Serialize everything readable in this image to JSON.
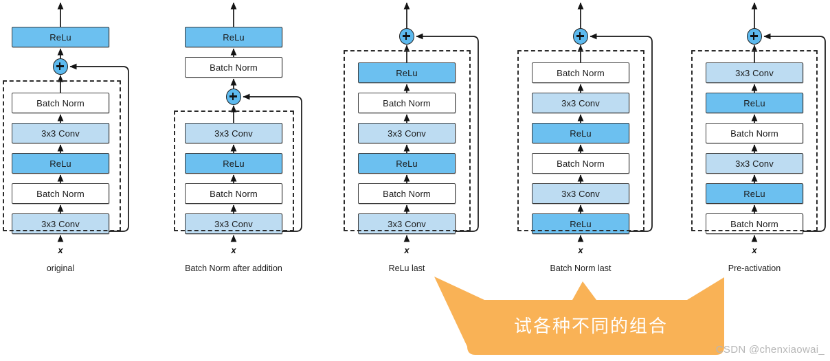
{
  "diagram": {
    "title": "ResNet block variants",
    "colors": {
      "relu_fill": "#6cc0f0",
      "conv_fill": "#bddcf2",
      "bn_fill": "#ffffff",
      "plus_fill": "#5cb9ee",
      "stroke": "#3b3b3b",
      "banner_fill": "#f9b košt"
    },
    "input_label": "x",
    "plus_label": "+",
    "columns": [
      {
        "caption": "original",
        "outside_top_blocks": [
          {
            "label": "ReLu",
            "kind": "relu"
          }
        ],
        "inside_blocks": [
          {
            "label": "Batch Norm",
            "kind": "bn"
          },
          {
            "label": "3x3 Conv",
            "kind": "conv"
          },
          {
            "label": "ReLu",
            "kind": "relu"
          },
          {
            "label": "Batch Norm",
            "kind": "bn"
          },
          {
            "label": "3x3 Conv",
            "kind": "conv"
          }
        ]
      },
      {
        "caption": "Batch Norm after addition",
        "outside_top_blocks": [
          {
            "label": "ReLu",
            "kind": "relu"
          },
          {
            "label": "Batch Norm",
            "kind": "bn"
          }
        ],
        "inside_blocks": [
          {
            "label": "3x3 Conv",
            "kind": "conv"
          },
          {
            "label": "ReLu",
            "kind": "relu"
          },
          {
            "label": "Batch Norm",
            "kind": "bn"
          },
          {
            "label": "3x3 Conv",
            "kind": "conv"
          }
        ]
      },
      {
        "caption": "ReLu last",
        "outside_top_blocks": [],
        "inside_blocks": [
          {
            "label": "ReLu",
            "kind": "relu"
          },
          {
            "label": "Batch Norm",
            "kind": "bn"
          },
          {
            "label": "3x3 Conv",
            "kind": "conv"
          },
          {
            "label": "ReLu",
            "kind": "relu"
          },
          {
            "label": "Batch Norm",
            "kind": "bn"
          },
          {
            "label": "3x3 Conv",
            "kind": "conv"
          }
        ]
      },
      {
        "caption": "Batch Norm last",
        "outside_top_blocks": [],
        "inside_blocks": [
          {
            "label": "Batch Norm",
            "kind": "bn"
          },
          {
            "label": "3x3 Conv",
            "kind": "conv"
          },
          {
            "label": "ReLu",
            "kind": "relu"
          },
          {
            "label": "Batch Norm",
            "kind": "bn"
          },
          {
            "label": "3x3 Conv",
            "kind": "conv"
          },
          {
            "label": "ReLu",
            "kind": "relu"
          }
        ]
      },
      {
        "caption": "Pre-activation",
        "outside_top_blocks": [],
        "inside_blocks": [
          {
            "label": "3x3 Conv",
            "kind": "conv"
          },
          {
            "label": "ReLu",
            "kind": "relu"
          },
          {
            "label": "Batch Norm",
            "kind": "bn"
          },
          {
            "label": "3x3 Conv",
            "kind": "conv"
          },
          {
            "label": "ReLu",
            "kind": "relu"
          },
          {
            "label": "Batch Norm",
            "kind": "bn"
          }
        ]
      }
    ]
  },
  "callout": {
    "text": "试各种不同的组合",
    "fill": "#f9b košt"
  },
  "watermark": {
    "text": "CSDN @chenxiaowai_"
  }
}
